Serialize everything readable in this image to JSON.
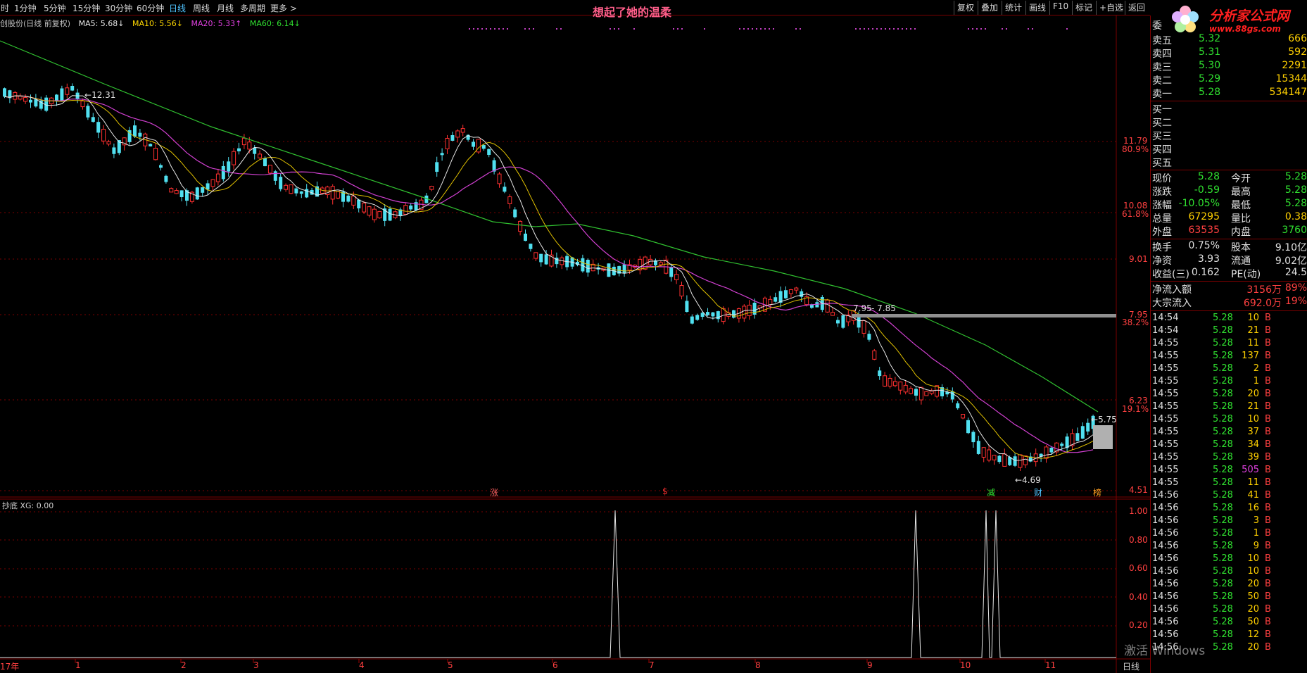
{
  "periods": [
    {
      "label": "时",
      "active": false
    },
    {
      "label": "1分钟",
      "active": false
    },
    {
      "label": "5分钟",
      "active": false
    },
    {
      "label": "15分钟",
      "active": false
    },
    {
      "label": "30分钟",
      "active": false
    },
    {
      "label": "60分钟",
      "active": false
    },
    {
      "label": "日线",
      "active": true
    },
    {
      "label": "周线",
      "active": false
    },
    {
      "label": "月线",
      "active": false
    },
    {
      "label": "多周期",
      "active": false
    },
    {
      "label": "更多 >",
      "active": false
    }
  ],
  "title": "想起了她的温柔",
  "toolbar": [
    "复权",
    "叠加",
    "统计",
    "画线",
    "F10",
    "标记",
    "+自选",
    "返回"
  ],
  "stock": {
    "name_info": "创股份(日线 前复权)"
  },
  "ma_legend": [
    {
      "label": "MA5: 5.68↓",
      "color": "#e8e8e8"
    },
    {
      "label": "MA10: 5.56↓",
      "color": "#ffd800"
    },
    {
      "label": "MA20: 5.33↑",
      "color": "#e040e0"
    },
    {
      "label": "MA60: 6.14↓",
      "color": "#30e030"
    }
  ],
  "price_axis": [
    {
      "price": "11.79",
      "pct": "80.9%"
    },
    {
      "price": "10.08",
      "pct": "61.8%"
    },
    {
      "price": "9.01",
      "pct": ""
    },
    {
      "price": "7.95",
      "pct": "38.2%"
    },
    {
      "price": "6.23",
      "pct": "19.1%"
    },
    {
      "price": "4.51",
      "pct": ""
    }
  ],
  "annotations": {
    "high": "12.31",
    "low": "4.69",
    "last": "5.75",
    "level_left": "7.95",
    "level_right": "7.85"
  },
  "event_markers": [
    {
      "label": "涨",
      "color": "#ff6060"
    },
    {
      "label": "$",
      "color": "#ff3030"
    },
    {
      "label": "减",
      "color": "#30e030"
    },
    {
      "label": "财",
      "color": "#4fc3ff"
    },
    {
      "label": "榜",
      "color": "#ffa020"
    }
  ],
  "indicator": {
    "title": "抄底 XG: 0.00",
    "axis": [
      "1.00",
      "0.80",
      "0.60",
      "0.40",
      "0.20"
    ]
  },
  "date_axis": [
    "17年",
    "1",
    "2",
    "3",
    "4",
    "5",
    "6",
    "7",
    "8",
    "9",
    "10",
    "11"
  ],
  "period_label": "日线",
  "order_book": {
    "header": "委",
    "asks": [
      {
        "label": "卖五",
        "price": "5.32",
        "vol": "666"
      },
      {
        "label": "卖四",
        "price": "5.31",
        "vol": "592"
      },
      {
        "label": "卖三",
        "price": "5.30",
        "vol": "2291"
      },
      {
        "label": "卖二",
        "price": "5.29",
        "vol": "15344"
      },
      {
        "label": "卖一",
        "price": "5.28",
        "vol": "534147"
      }
    ],
    "bids": [
      {
        "label": "买一"
      },
      {
        "label": "买二"
      },
      {
        "label": "买三"
      },
      {
        "label": "买四"
      },
      {
        "label": "买五"
      }
    ]
  },
  "quote": [
    {
      "l1": "现价",
      "v1": "5.28",
      "c1": "#30e030",
      "l2": "今开",
      "v2": "5.28",
      "c2": "#30e030"
    },
    {
      "l1": "涨跌",
      "v1": "-0.59",
      "c1": "#30e030",
      "l2": "最高",
      "v2": "5.28",
      "c2": "#30e030"
    },
    {
      "l1": "涨幅",
      "v1": "-10.05%",
      "c1": "#30e030",
      "l2": "最低",
      "v2": "5.28",
      "c2": "#30e030"
    },
    {
      "l1": "总量",
      "v1": "67295",
      "c1": "#ffd000",
      "l2": "量比",
      "v2": "0.38",
      "c2": "#ffd000"
    },
    {
      "l1": "外盘",
      "v1": "63535",
      "c1": "#ff4040",
      "l2": "内盘",
      "v2": "3760",
      "c2": "#30e030"
    }
  ],
  "finance": [
    {
      "l1": "换手",
      "v1": "0.75%",
      "l2": "股本",
      "v2": "9.10亿"
    },
    {
      "l1": "净资",
      "v1": "3.93",
      "l2": "流通",
      "v2": "9.02亿"
    },
    {
      "l1": "收益(三)",
      "v1": "0.162",
      "l2": "PE(动)",
      "v2": "24.5"
    }
  ],
  "flows": [
    {
      "label": "净流入额",
      "v": "3156万",
      "pct": "89%"
    },
    {
      "label": "大宗流入",
      "v": "692.0万",
      "pct": "19%"
    }
  ],
  "ticks": [
    {
      "t": "14:54",
      "p": "5.28",
      "v": "10",
      "b": "B"
    },
    {
      "t": "14:54",
      "p": "5.28",
      "v": "21",
      "b": "B"
    },
    {
      "t": "14:55",
      "p": "5.28",
      "v": "11",
      "b": "B"
    },
    {
      "t": "14:55",
      "p": "5.28",
      "v": "137",
      "b": "B"
    },
    {
      "t": "14:55",
      "p": "5.28",
      "v": "2",
      "b": "B"
    },
    {
      "t": "14:55",
      "p": "5.28",
      "v": "1",
      "b": "B"
    },
    {
      "t": "14:55",
      "p": "5.28",
      "v": "20",
      "b": "B"
    },
    {
      "t": "14:55",
      "p": "5.28",
      "v": "21",
      "b": "B"
    },
    {
      "t": "14:55",
      "p": "5.28",
      "v": "10",
      "b": "B"
    },
    {
      "t": "14:55",
      "p": "5.28",
      "v": "37",
      "b": "B"
    },
    {
      "t": "14:55",
      "p": "5.28",
      "v": "34",
      "b": "B"
    },
    {
      "t": "14:55",
      "p": "5.28",
      "v": "39",
      "b": "B"
    },
    {
      "t": "14:55",
      "p": "5.28",
      "v": "505",
      "b": "B"
    },
    {
      "t": "14:55",
      "p": "5.28",
      "v": "11",
      "b": "B"
    },
    {
      "t": "14:56",
      "p": "5.28",
      "v": "41",
      "b": "B"
    },
    {
      "t": "14:56",
      "p": "5.28",
      "v": "16",
      "b": "B"
    },
    {
      "t": "14:56",
      "p": "5.28",
      "v": "3",
      "b": "B"
    },
    {
      "t": "14:56",
      "p": "5.28",
      "v": "1",
      "b": "B"
    },
    {
      "t": "14:56",
      "p": "5.28",
      "v": "9",
      "b": "B"
    },
    {
      "t": "14:56",
      "p": "5.28",
      "v": "10",
      "b": "B"
    },
    {
      "t": "14:56",
      "p": "5.28",
      "v": "10",
      "b": "B"
    },
    {
      "t": "14:56",
      "p": "5.28",
      "v": "20",
      "b": "B"
    },
    {
      "t": "14:56",
      "p": "5.28",
      "v": "50",
      "b": "B"
    },
    {
      "t": "14:56",
      "p": "5.28",
      "v": "20",
      "b": "B"
    },
    {
      "t": "14:56",
      "p": "5.28",
      "v": "50",
      "b": "B"
    },
    {
      "t": "14:56",
      "p": "5.28",
      "v": "12",
      "b": "B"
    },
    {
      "t": "14:56",
      "p": "5.28",
      "v": "20",
      "b": "B"
    }
  ],
  "logo": {
    "text": "分析家公式网",
    "url": "www.88gs.com"
  },
  "watermark": "激活 Windows"
}
